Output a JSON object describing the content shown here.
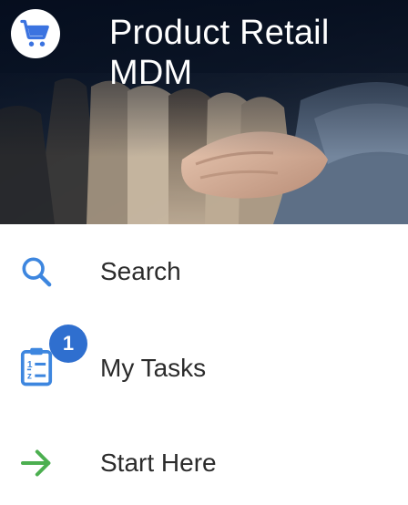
{
  "header": {
    "title": "Product Retail MDM",
    "logo_icon": "shopping-cart-icon",
    "logo_color": "#3b73e0"
  },
  "menu": {
    "items": [
      {
        "label": "Search",
        "icon": "search-icon",
        "icon_color": "#3d86df"
      },
      {
        "label": "My Tasks",
        "icon": "clipboard-list-icon",
        "icon_color": "#3d86df",
        "badge": "1",
        "badge_color": "#2f6fcf"
      },
      {
        "label": "Start Here",
        "icon": "arrow-right-icon",
        "icon_color": "#4caf50"
      }
    ]
  }
}
